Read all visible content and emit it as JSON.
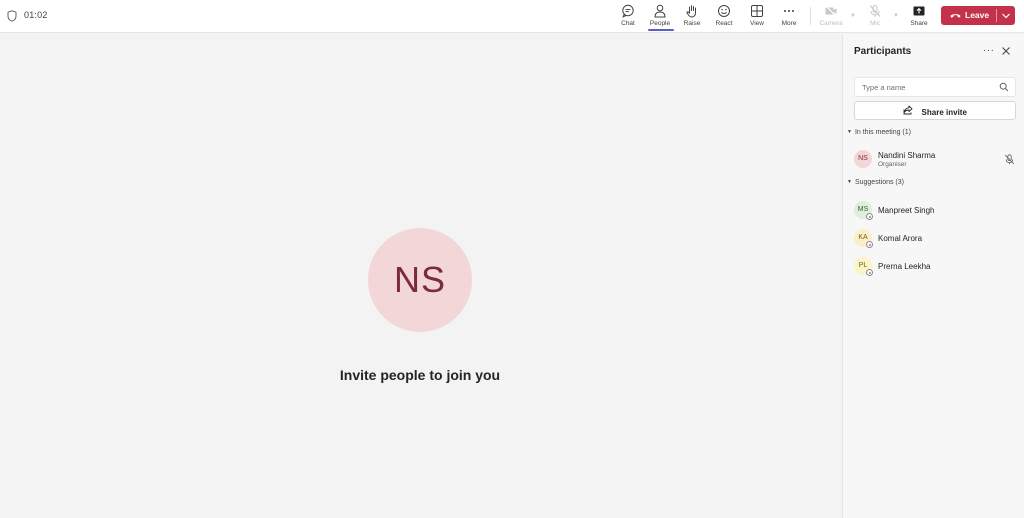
{
  "header": {
    "timer": "01:02",
    "toolbar": [
      {
        "key": "chat",
        "label": "Chat",
        "icon": "chat-icon"
      },
      {
        "key": "people",
        "label": "People",
        "icon": "people-icon"
      },
      {
        "key": "raise",
        "label": "Raise",
        "icon": "hand-icon"
      },
      {
        "key": "react",
        "label": "React",
        "icon": "smiley-icon"
      },
      {
        "key": "view",
        "label": "View",
        "icon": "grid-icon"
      },
      {
        "key": "more",
        "label": "More",
        "icon": "more-icon"
      },
      {
        "key": "camera",
        "label": "Camera",
        "icon": "camera-off-icon"
      },
      {
        "key": "mic",
        "label": "Mic",
        "icon": "mic-off-icon"
      },
      {
        "key": "share",
        "label": "Share",
        "icon": "share-screen-icon"
      }
    ],
    "leave_label": "Leave",
    "leave_color": "#c4314b",
    "accent_color": "#5b5fc7"
  },
  "stage": {
    "avatar_initials": "NS",
    "invite_text": "Invite people to join you"
  },
  "panel": {
    "title": "Participants",
    "search_placeholder": "Type a name",
    "share_invite_label": "Share invite",
    "in_meeting": {
      "label": "In this meeting (1)",
      "people": [
        {
          "initials": "NS",
          "name": "Nandini Sharma",
          "role": "Organiser"
        }
      ]
    },
    "suggestions": {
      "label": "Suggestions (3)",
      "people": [
        {
          "initials": "MS",
          "name": "Manpreet Singh"
        },
        {
          "initials": "KA",
          "name": "Komal Arora"
        },
        {
          "initials": "PL",
          "name": "Prerna Leekha"
        }
      ]
    }
  }
}
